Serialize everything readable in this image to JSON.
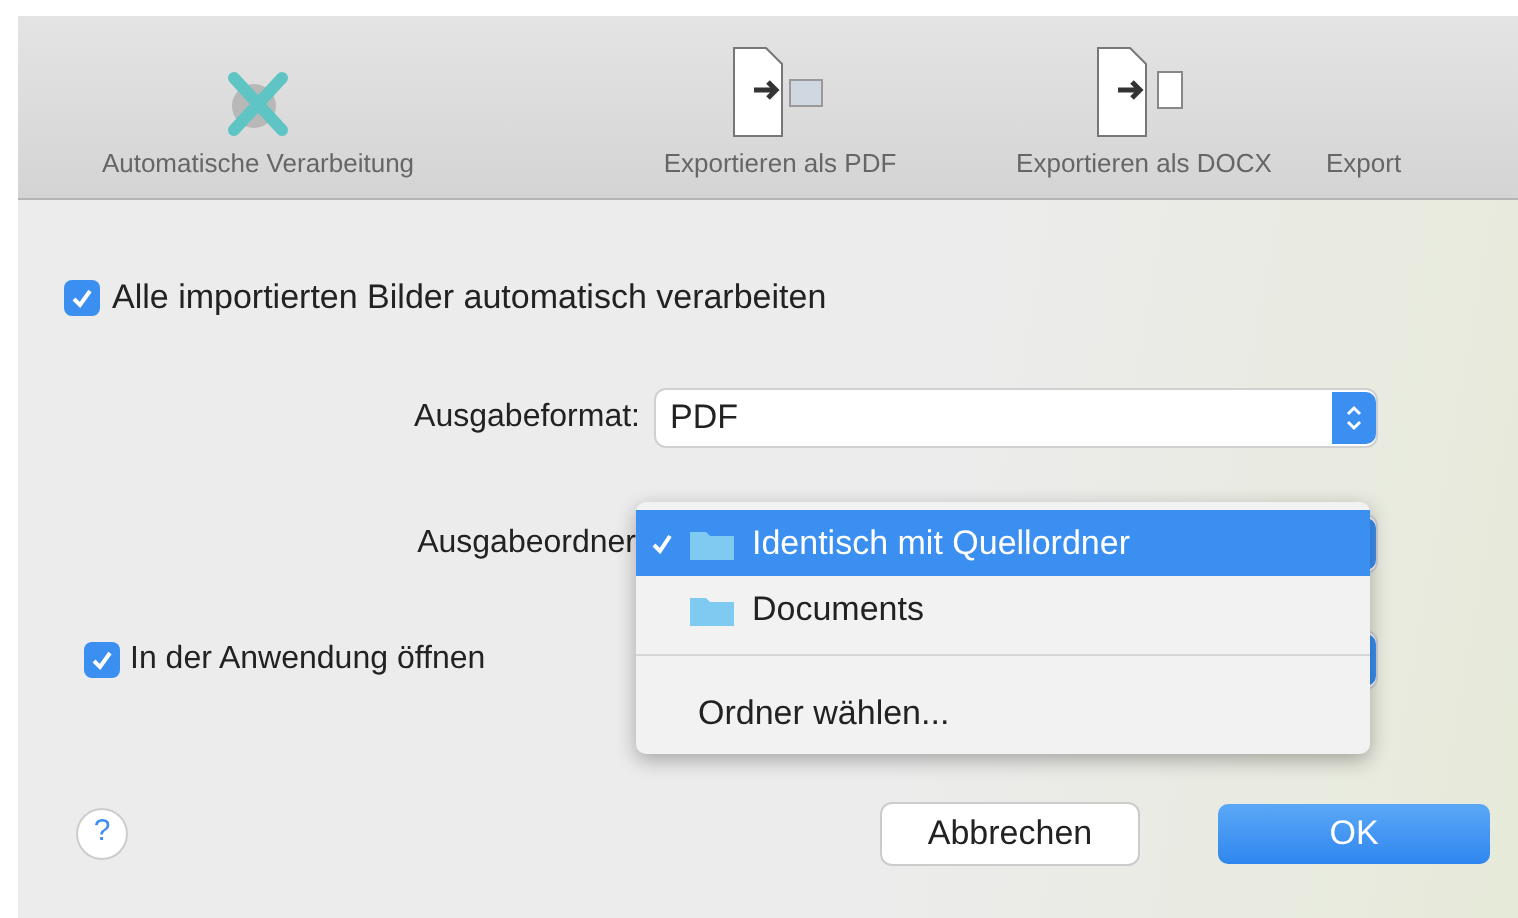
{
  "toolbar": [
    {
      "label": "Automatische Verarbeitung",
      "kind": "auto"
    },
    {
      "label": "Exportieren als PDF",
      "kind": "pdf"
    },
    {
      "label": "Exportieren als DOCX",
      "kind": "docx"
    },
    {
      "label": "Export",
      "kind": "other"
    }
  ],
  "auto_process": {
    "label": "Alle importierten Bilder automatisch verarbeiten",
    "checked": true
  },
  "output_format": {
    "label": "Ausgabeformat:",
    "value": "PDF"
  },
  "output_folder": {
    "label": "Ausgabeordner"
  },
  "open_in_app": {
    "label": "In der Anwendung öffnen",
    "checked": true
  },
  "menu": [
    {
      "label": "Identisch mit Quellordner",
      "kind": "folder",
      "selected": true
    },
    {
      "label": "Documents",
      "kind": "folder",
      "selected": false
    },
    {
      "kind": "separator"
    },
    {
      "label": "Ordner wählen...",
      "kind": "action",
      "selected": false
    }
  ],
  "help": "?",
  "buttons": [
    {
      "label": "Abbrechen",
      "kind": "cancel"
    },
    {
      "label": "OK",
      "kind": "default"
    }
  ]
}
